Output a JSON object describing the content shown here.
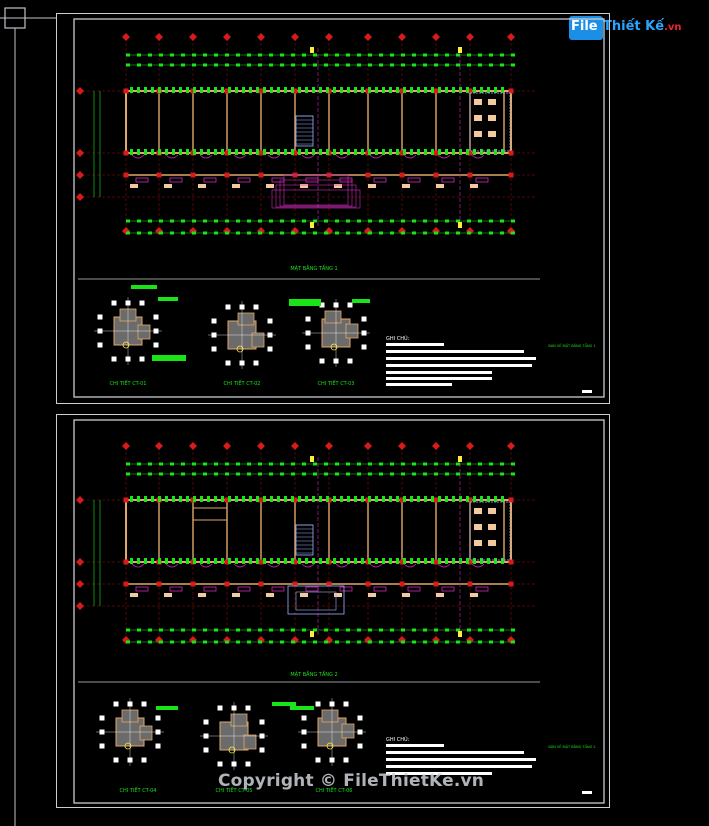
{
  "logo": {
    "prefix": "File",
    "name": "Thiết Kế",
    "tld": ".vn"
  },
  "sheet1": {
    "plan_title": "MẶT BẰNG TẦNG 1",
    "details": [
      "CHI TIẾT CT-01",
      "CHI TIẾT CT-02",
      "CHI TIẾT CT-03"
    ],
    "notes_title": "GHI CHÚ:",
    "side_label": "BẢN VẼ MẶT BẰNG TẦNG 1"
  },
  "sheet2": {
    "plan_title": "MẶT BẰNG TẦNG 2",
    "details": [
      "CHI TIẾT CT-04",
      "CHI TIẾT CT-05",
      "CHI TIẾT CT-06"
    ],
    "notes_title": "GHI CHÚ:",
    "side_label": "BẢN VẼ MẶT BẰNG TẦNG 2"
  },
  "copyright": "Copyright © FileThietKe.vn",
  "colors": {
    "background": "#000000",
    "frame": "#c9ccd1",
    "grid_axis": "#d81a1a",
    "dimension": "#18e418",
    "wall": "#e0a86a",
    "furniture": "#d12ab8",
    "text": "#ffffff",
    "stair": "#9ab0ff"
  }
}
